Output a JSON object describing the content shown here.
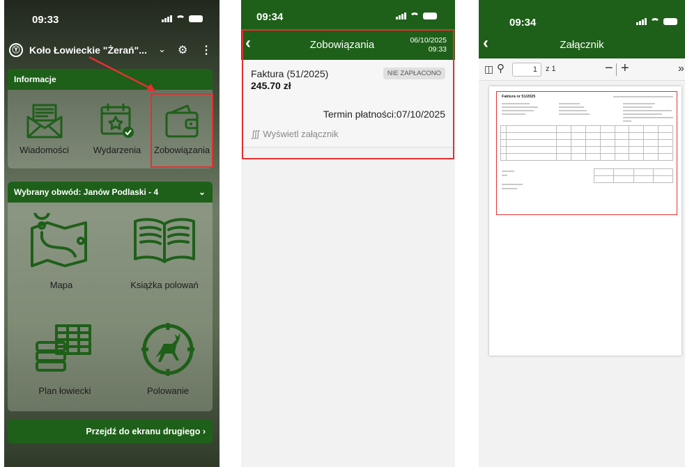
{
  "phone1": {
    "time": "09:33",
    "club_name": "Koło Łowieckie \"Żerań\"...",
    "club_logo": "Ⓨ",
    "info_section": "Informacje",
    "tiles_info": [
      {
        "label": "Wiadomości",
        "icon": "mail-icon"
      },
      {
        "label": "Wydarzenia",
        "icon": "calendar-icon"
      },
      {
        "label": "Zobowiązania",
        "icon": "wallet-icon"
      }
    ],
    "district_section": "Wybrany obwód: Janów Podlaski - 4",
    "tiles_district": [
      {
        "label": "Mapa",
        "icon": "map-icon"
      },
      {
        "label": "Książka polowań",
        "icon": "book-icon"
      },
      {
        "label": "Plan łowiecki",
        "icon": "table-icon"
      },
      {
        "label": "Polowanie",
        "icon": "deer-icon"
      }
    ],
    "next_screen_button": "Przejdź do ekranu drugiego"
  },
  "phone2": {
    "time": "09:34",
    "title": "Zobowiązania",
    "date_line1": "06/10/2025",
    "date_line2": "09:33",
    "invoice_title": "Faktura (51/2025)",
    "invoice_amount": "245.70 zł",
    "status_badge": "NIE ZAPŁACONO",
    "due_date": "Termin płatności:07/10/2025",
    "attachment_link": "Wyświetl załącznik"
  },
  "phone3": {
    "time": "09:34",
    "title": "Załącznik",
    "page_number": "1",
    "page_of": "z 1",
    "pdf": {
      "invoice_heading": "Faktura nr 51/2025"
    }
  },
  "colors": {
    "brand_green": "#1e5f19",
    "highlight_red": "#e23030"
  }
}
